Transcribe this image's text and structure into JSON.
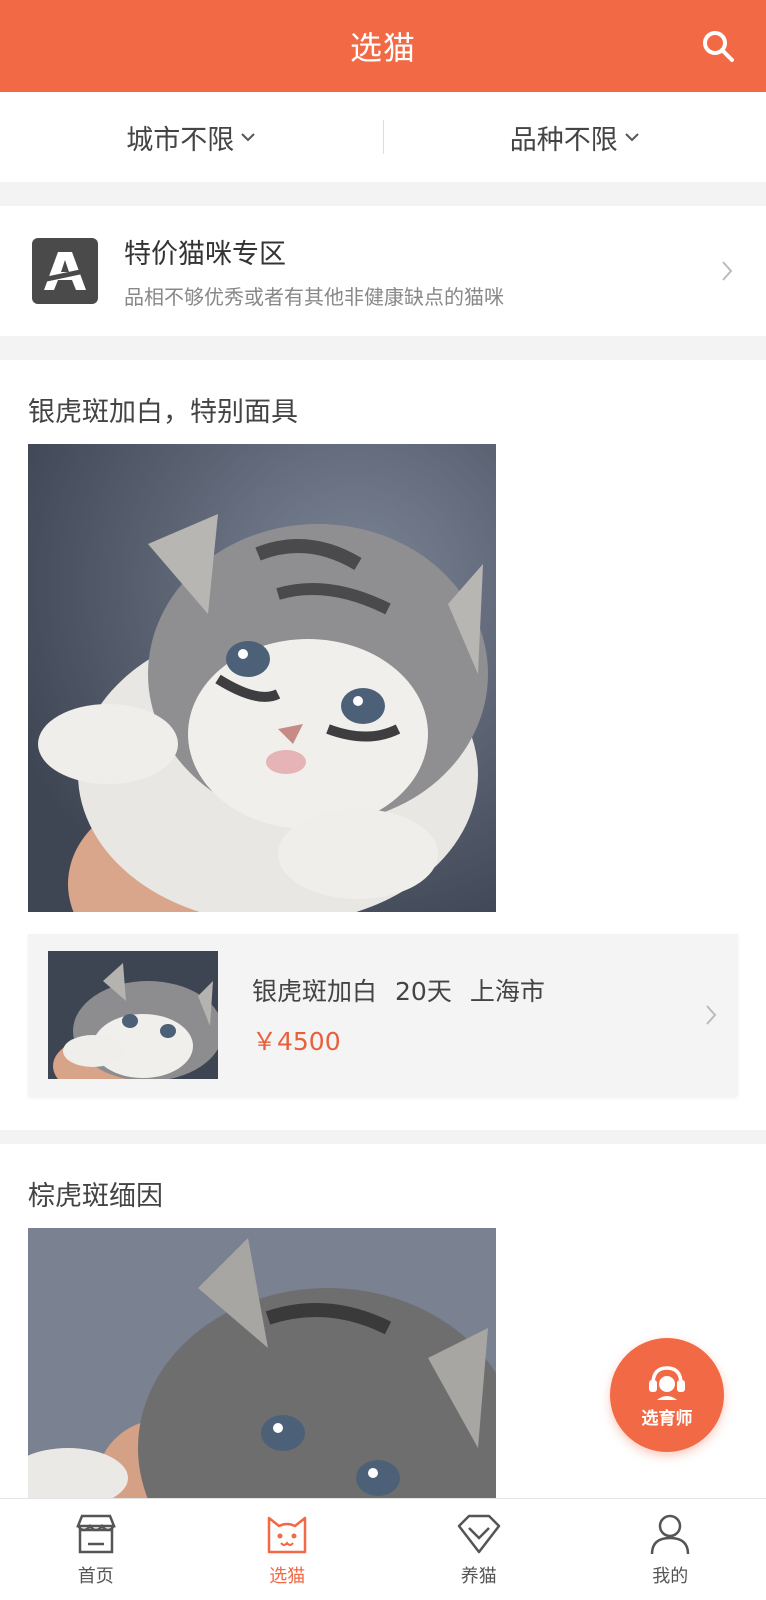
{
  "header": {
    "title": "选猫",
    "search_icon": "search-icon"
  },
  "filters": [
    {
      "label": "城市不限"
    },
    {
      "label": "品种不限"
    }
  ],
  "promo": {
    "title": "特价猫咪专区",
    "subtitle": "品相不够优秀或者有其他非健康缺点的猫咪",
    "logo_letter": "A"
  },
  "listings": [
    {
      "title": "银虎斑加白，特别面具",
      "breed": "银虎斑加白",
      "age": "20天",
      "city": "上海市",
      "price": "￥4500"
    },
    {
      "title": "棕虎斑缅因"
    }
  ],
  "fab": {
    "label": "选育师"
  },
  "tabbar": [
    {
      "label": "首页",
      "icon": "shop-icon"
    },
    {
      "label": "选猫",
      "icon": "cat-face-icon",
      "active": true
    },
    {
      "label": "养猫",
      "icon": "diamond-icon"
    },
    {
      "label": "我的",
      "icon": "user-icon"
    }
  ],
  "colors": {
    "accent": "#f26a45",
    "price": "#e8603c"
  }
}
